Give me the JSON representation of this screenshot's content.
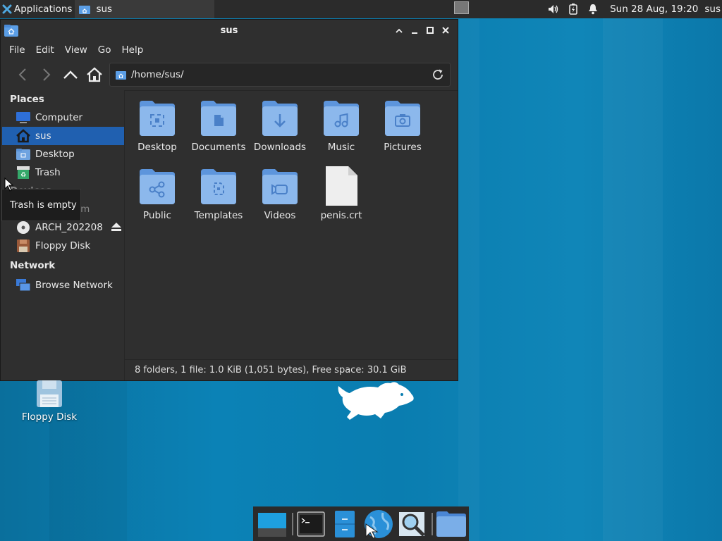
{
  "top_panel": {
    "applications_label": "Applications",
    "task_label": "sus",
    "clock": "Sun 28 Aug, 19:20",
    "user": "sus"
  },
  "window": {
    "title": "sus",
    "menu": [
      "File",
      "Edit",
      "View",
      "Go",
      "Help"
    ],
    "location_path": "/home/sus/",
    "sidebar": {
      "places_heading": "Places",
      "places": [
        "Computer",
        "sus",
        "Desktop",
        "Trash"
      ],
      "devices_heading": "Devices",
      "devices": [
        "File System",
        "ARCH_202208",
        "Floppy Disk"
      ],
      "network_heading": "Network",
      "network": [
        "Browse Network"
      ]
    },
    "items": [
      {
        "name": "Desktop",
        "kind": "desktop-folder"
      },
      {
        "name": "Documents",
        "kind": "documents-folder"
      },
      {
        "name": "Downloads",
        "kind": "downloads-folder"
      },
      {
        "name": "Music",
        "kind": "music-folder"
      },
      {
        "name": "Pictures",
        "kind": "pictures-folder"
      },
      {
        "name": "Public",
        "kind": "public-folder"
      },
      {
        "name": "Templates",
        "kind": "templates-folder"
      },
      {
        "name": "Videos",
        "kind": "videos-folder"
      },
      {
        "name": "penis.crt",
        "kind": "file"
      }
    ],
    "status": "8 folders, 1 file: 1.0 KiB (1,051 bytes), Free space: 30.1 GiB"
  },
  "tooltip": "Trash is empty",
  "desktop_icons": [
    {
      "label": "Floppy Disk"
    }
  ],
  "colors": {
    "selection": "#2060b0",
    "folder": "#7aaee8",
    "desktop": "#0a7db0"
  }
}
